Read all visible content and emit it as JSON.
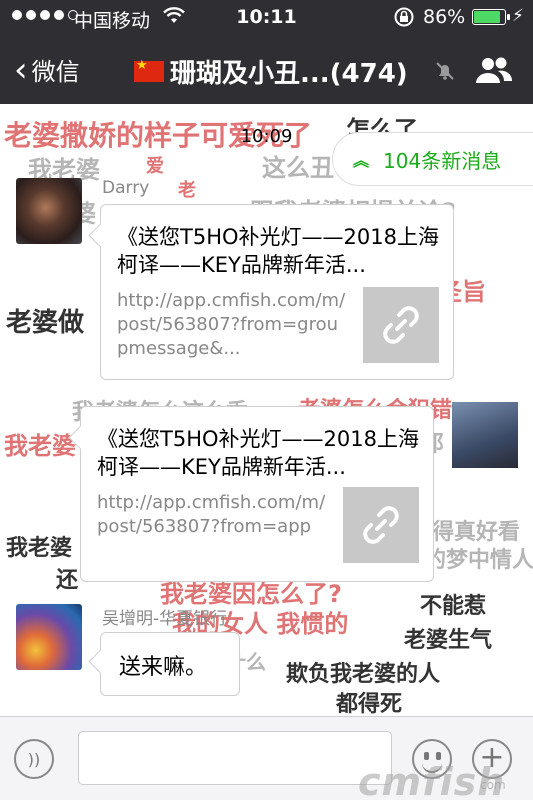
{
  "status_bar": {
    "carrier": "中国移动",
    "time": "10:11",
    "battery_percent": "86%",
    "battery_level": 0.86
  },
  "nav": {
    "back_label": "微信",
    "title": "珊瑚及小丑...(474)"
  },
  "chat": {
    "timestamp": "10:09",
    "new_messages_label": "104条新消息",
    "background_texts": [
      "老婆撒娇的样子可爱死了",
      "怎么了",
      "我老婆",
      "爱",
      "这么丑",
      "老",
      "跟我老婆相提并论?",
      "我老婆",
      "圣旨",
      "老婆做",
      "我爱老婆",
      "我老婆怎么这么香",
      "老婆怎么会犯错",
      "我老婆",
      "邓",
      "得真好看",
      "我老婆",
      "的梦中情人",
      "还",
      "我老婆因怎么了?",
      "我的女人 我惯的",
      "不能惹",
      "老婆生气",
      "什么",
      "欺负我老婆的人",
      "都得死"
    ],
    "messages": [
      {
        "sender": "Darry",
        "card_title": "《送您T5HO补光灯——2018上海柯译——KEY品牌新年活...",
        "card_desc": "http://app.cmfish.com/m/post/563807?from=groupmessage&..."
      },
      {
        "sender": "",
        "card_title": "《送您T5HO补光灯——2018上海柯译——KEY品牌新年活...",
        "card_desc": "http://app.cmfish.com/m/post/563807?from=app"
      },
      {
        "sender": "吴增明-华夏银行",
        "text": "送来嘛。"
      }
    ]
  },
  "watermark": "cmfish",
  "watermark_sub": "com",
  "colors": {
    "nav_bg": "#2f2f33",
    "accent_green": "#1aad19",
    "battery_green": "#4cd964",
    "bg_text_red": "#d9534f",
    "bg_text_gray": "#9a9a9a"
  }
}
